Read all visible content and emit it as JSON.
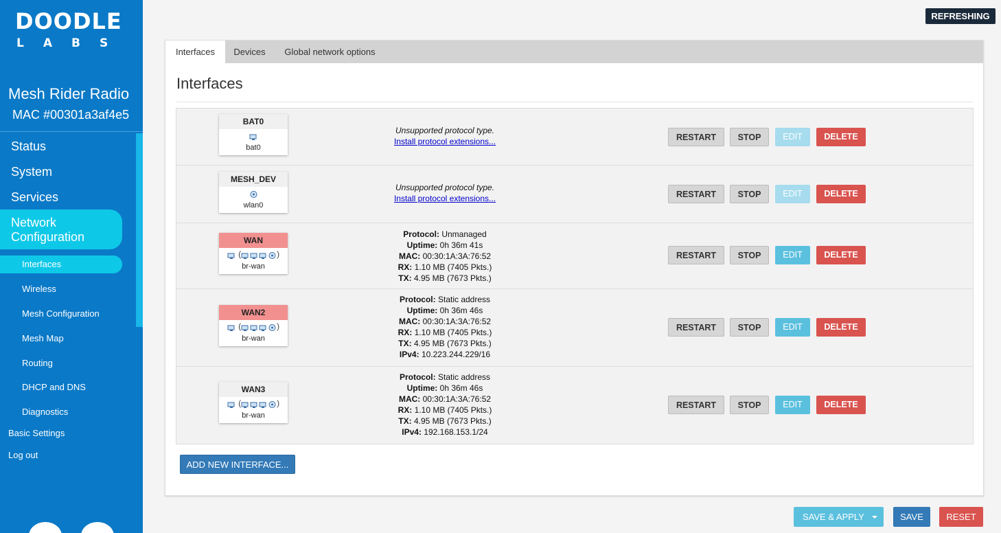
{
  "brand": {
    "logo_top": "DOODLE",
    "logo_bottom": "LABS"
  },
  "device": {
    "name": "Mesh Rider Radio",
    "mac": "MAC #00301a3af4e5"
  },
  "nav": {
    "main": [
      "Status",
      "System",
      "Services"
    ],
    "active": "Network Configuration",
    "sub_active": "Interfaces",
    "sub": [
      "Wireless",
      "Mesh Configuration",
      "Mesh Map",
      "Routing",
      "DHCP and DNS",
      "Diagnostics"
    ],
    "bottom": [
      "Basic Settings",
      "Log out"
    ]
  },
  "status_badge": "REFRESHING",
  "tabs": [
    "Interfaces",
    "Devices",
    "Global network options"
  ],
  "page_title": "Interfaces",
  "buttons": {
    "restart": "RESTART",
    "stop": "STOP",
    "edit": "EDIT",
    "delete": "DELETE"
  },
  "interfaces": [
    {
      "name": "BAT0",
      "device": "bat0",
      "unsupported": "Unsupported protocol type.",
      "install_link": "Install protocol extensions...",
      "edit_enabled": false
    },
    {
      "name": "MESH_DEV",
      "device": "wlan0",
      "unsupported": "Unsupported protocol type.",
      "install_link": "Install protocol extensions...",
      "edit_enabled": false
    },
    {
      "name": "WAN",
      "device": "br-wan",
      "edit_enabled": true,
      "fields": [
        {
          "label": "Protocol:",
          "value": "Unmanaged"
        },
        {
          "label": "Uptime:",
          "value": "0h 36m 41s"
        },
        {
          "label": "MAC:",
          "value": "00:30:1A:3A:76:52"
        },
        {
          "label": "RX:",
          "value": "1.10 MB (7405 Pkts.)"
        },
        {
          "label": "TX:",
          "value": "4.95 MB (7673 Pkts.)"
        }
      ]
    },
    {
      "name": "WAN2",
      "device": "br-wan",
      "edit_enabled": true,
      "fields": [
        {
          "label": "Protocol:",
          "value": "Static address"
        },
        {
          "label": "Uptime:",
          "value": "0h 36m 46s"
        },
        {
          "label": "MAC:",
          "value": "00:30:1A:3A:76:52"
        },
        {
          "label": "RX:",
          "value": "1.10 MB (7405 Pkts.)"
        },
        {
          "label": "TX:",
          "value": "4.95 MB (7673 Pkts.)"
        },
        {
          "label": "IPv4:",
          "value": "10.223.244.229/16"
        }
      ]
    },
    {
      "name": "WAN3",
      "device": "br-wan",
      "edit_enabled": true,
      "fields": [
        {
          "label": "Protocol:",
          "value": "Static address"
        },
        {
          "label": "Uptime:",
          "value": "0h 36m 46s"
        },
        {
          "label": "MAC:",
          "value": "00:30:1A:3A:76:52"
        },
        {
          "label": "RX:",
          "value": "1.10 MB (7405 Pkts.)"
        },
        {
          "label": "TX:",
          "value": "4.95 MB (7673 Pkts.)"
        },
        {
          "label": "IPv4:",
          "value": "192.168.153.1/24"
        }
      ]
    }
  ],
  "add_interface": "ADD NEW INTERFACE...",
  "actions": {
    "save_apply": "SAVE & APPLY",
    "save": "SAVE",
    "reset": "RESET"
  }
}
